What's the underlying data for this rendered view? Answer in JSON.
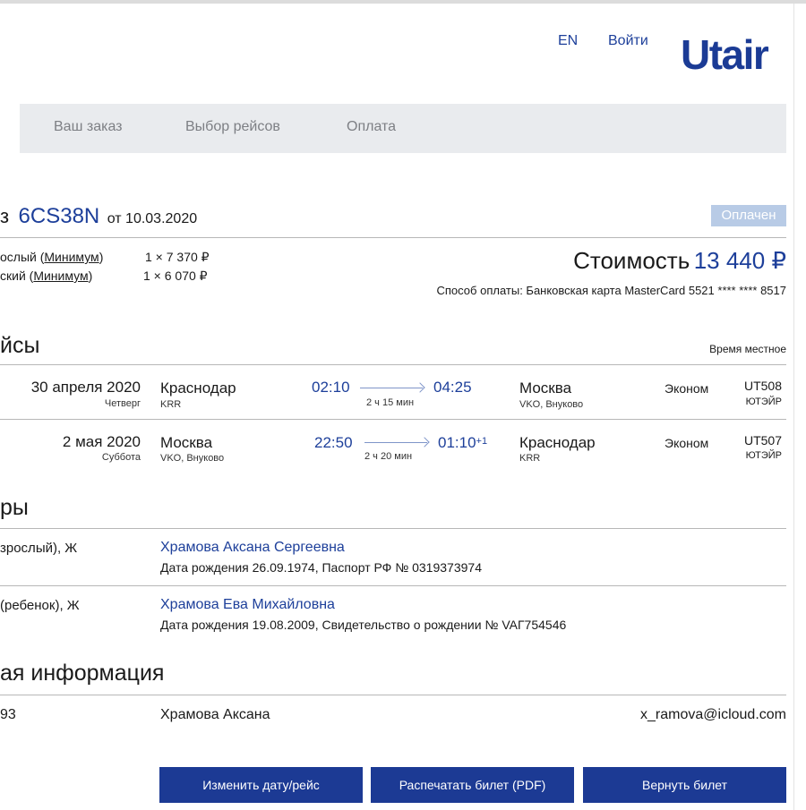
{
  "header": {
    "lang": "EN",
    "login": "Войти",
    "logo": "Utair"
  },
  "steps": [
    "Ваш заказ",
    "Выбор рейсов",
    "Оплата"
  ],
  "order": {
    "prefix": "з",
    "code": "6CS38N",
    "date": "от 10.03.2020",
    "status": "Оплачен"
  },
  "fares": [
    {
      "type_prefix": "ослый (",
      "tariff": "Минимум",
      "type_suffix": ")",
      "amount": "1 × 7 370 ₽"
    },
    {
      "type_prefix": "ский (",
      "tariff": "Минимум",
      "type_suffix": ")",
      "amount": "1 × 6 070 ₽"
    }
  ],
  "price": {
    "label": "Стоимость",
    "value": "13 440 ₽",
    "payment": "Способ оплаты: Банковская карта MasterCard 5521 **** **** 8517"
  },
  "flights_section": {
    "title": "йсы",
    "local_time": "Время местное"
  },
  "flights": [
    {
      "date": "30 апреля 2020",
      "weekday": "Четверг",
      "from_city": "Краснодар",
      "from_code": "KRR",
      "dep": "02:10",
      "arr": "04:25",
      "arr_sup": "",
      "duration": "2 ч 15 мин",
      "to_city": "Москва",
      "to_code": "VKO, Внуково",
      "class": "Эконом",
      "number": "UT508",
      "airline": "ЮТЭЙР"
    },
    {
      "date": "2 мая 2020",
      "weekday": "Суббота",
      "from_city": "Москва",
      "from_code": "VKO, Внуково",
      "dep": "22:50",
      "arr": "01:10",
      "arr_sup": "+1",
      "duration": "2 ч 20 мин",
      "to_city": "Краснодар",
      "to_code": "KRR",
      "class": "Эконом",
      "number": "UT507",
      "airline": "ЮТЭЙР"
    }
  ],
  "passengers_section": {
    "title": "ры"
  },
  "passengers": [
    {
      "type": "зрослый), Ж",
      "name": "Храмова Аксана Сергеевна",
      "doc": "Дата рождения 26.09.1974,    Паспорт РФ № 0319373974"
    },
    {
      "type": "(ребенок), Ж",
      "name": "Храмова Ева Михайловна",
      "doc": "Дата рождения 19.08.2009,    Свидетельство о рождении № VAГ754546"
    }
  ],
  "contact_section": {
    "title": "ая информация"
  },
  "contact": {
    "phone": "93",
    "name": "Храмова Аксана",
    "email": "x_ramova@icloud.com"
  },
  "buttons": {
    "change": "Изменить дату/рейс",
    "print": "Распечатать билет (PDF)",
    "refund": "Вернуть билет"
  }
}
